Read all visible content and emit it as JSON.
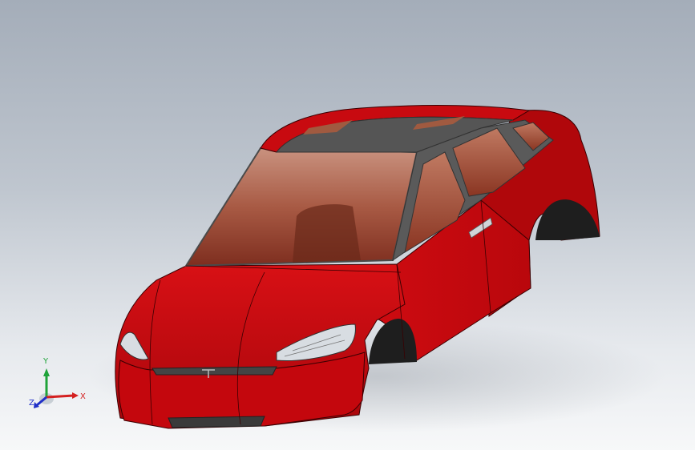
{
  "viewport": {
    "background_top": "#a4adb9",
    "background_bottom": "#f7f8f9"
  },
  "model": {
    "body_color": "#c8080f",
    "glass_color": "#9a4a38",
    "trim_color": "#5a5a5a",
    "tire_well_color": "#1e1e1e"
  },
  "triad": {
    "x_label": "X",
    "y_label": "Y",
    "z_label": "Z",
    "x_color": "#d42020",
    "y_color": "#1fa33a",
    "z_color": "#2030c8"
  }
}
